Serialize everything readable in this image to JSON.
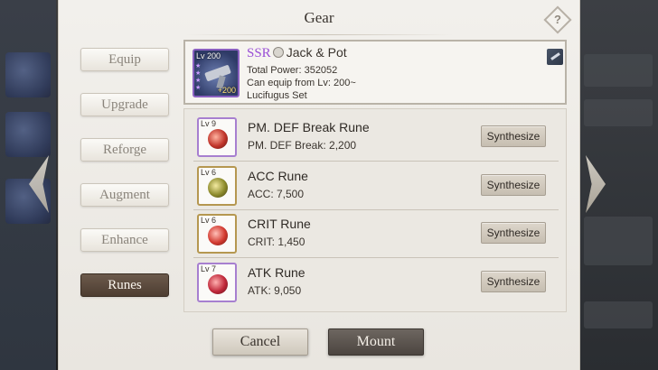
{
  "modal": {
    "title": "Gear"
  },
  "tabs": [
    {
      "label": "Equip",
      "active": false
    },
    {
      "label": "Upgrade",
      "active": false
    },
    {
      "label": "Reforge",
      "active": false
    },
    {
      "label": "Augment",
      "active": false
    },
    {
      "label": "Enhance",
      "active": false
    },
    {
      "label": "Runes",
      "active": true
    }
  ],
  "item": {
    "level": "Lv 200",
    "plus": "+200",
    "rarity": "SSR",
    "name": "Jack & Pot",
    "total_power": "Total Power: 352052",
    "equip_level": "Can equip from Lv: 200~",
    "set": "Lucifugus Set",
    "icon": "gun-icon"
  },
  "runes": [
    {
      "level": "Lv 9",
      "name": "PM. DEF Break Rune",
      "stat": "PM. DEF Break: 2,200",
      "button": "Synthesize",
      "frame": "purple"
    },
    {
      "level": "Lv 6",
      "name": "ACC Rune",
      "stat": "ACC: 7,500",
      "button": "Synthesize",
      "frame": "gold"
    },
    {
      "level": "Lv 6",
      "name": "CRIT Rune",
      "stat": "CRIT: 1,450",
      "button": "Synthesize",
      "frame": "gold"
    },
    {
      "level": "Lv 7",
      "name": "ATK Rune",
      "stat": "ATK: 9,050",
      "button": "Synthesize",
      "frame": "purple"
    }
  ],
  "footer": {
    "cancel_label": "Cancel",
    "mount_label": "Mount"
  },
  "colors": {
    "rarity_ssr": "#9a4fd6",
    "active_tab": "#5a4a3d"
  }
}
